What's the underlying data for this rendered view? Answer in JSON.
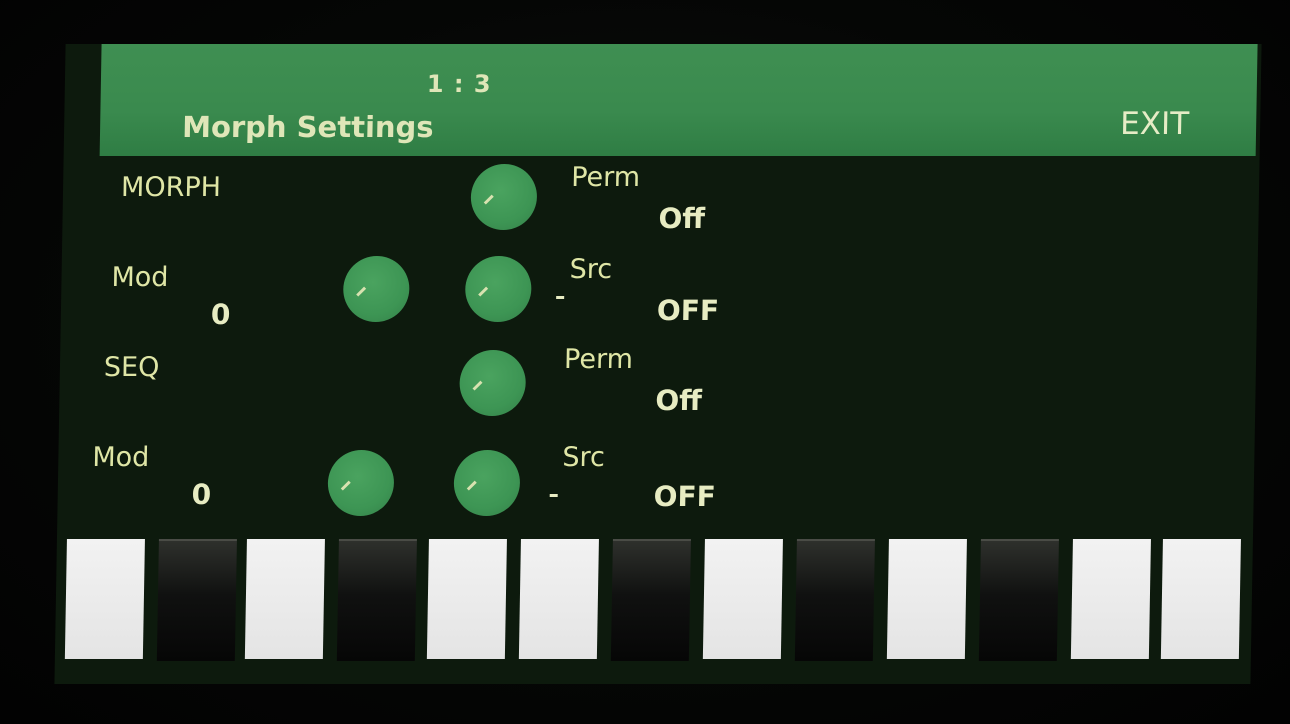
{
  "header": {
    "page": "1 : 3",
    "title": "Morph Settings",
    "exit_label": "EXIT"
  },
  "rows": [
    {
      "section": "MORPH",
      "right_label": "Perm",
      "right_value": "Off"
    },
    {
      "left_label": "Mod",
      "left_value": "0",
      "right_label": "Src",
      "right_value": "OFF"
    },
    {
      "section": "SEQ",
      "right_label": "Perm",
      "right_value": "Off"
    },
    {
      "left_label": "Mod",
      "left_value": "0",
      "right_label": "Src",
      "right_value": "OFF"
    }
  ],
  "keyboard": {
    "keys": [
      "white",
      "black",
      "white",
      "black",
      "white",
      "white",
      "black",
      "white",
      "black",
      "white",
      "black",
      "white",
      "white"
    ]
  },
  "colors": {
    "header_bg": "#3a8a4e",
    "screen_bg": "#0d1a0d",
    "knob": "#3d9554",
    "text": "#dfe6a6"
  }
}
